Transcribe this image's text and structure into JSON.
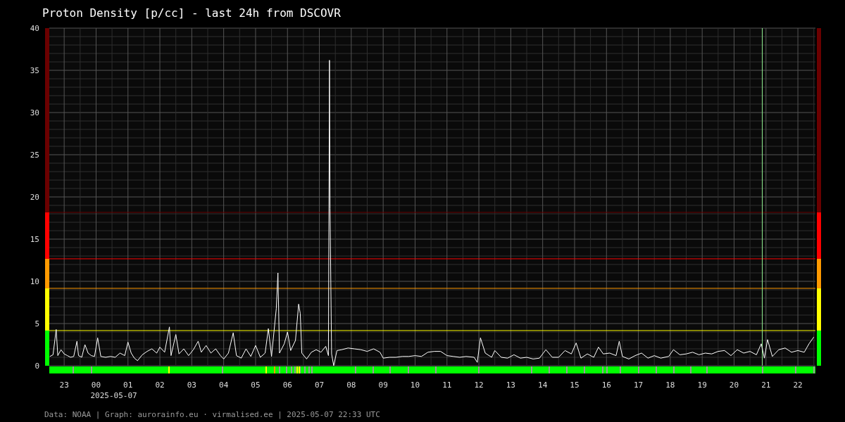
{
  "title": "Proton Density [p/cc] - last 24h from DSCOVR",
  "chart_data": {
    "type": "line",
    "grid": true,
    "xlim": [
      "2025-05-06 22:32",
      "2025-05-07 22:33"
    ],
    "ylim": [
      0,
      40
    ],
    "yticks": [
      0,
      5,
      10,
      15,
      20,
      25,
      30,
      35,
      40
    ],
    "ref_lines": [
      {
        "axis": "y",
        "value": 4.17,
        "color": "#ffff00"
      },
      {
        "axis": "y",
        "value": 9.17,
        "color": "#ff9900"
      },
      {
        "axis": "y",
        "value": 12.67,
        "color": "#ff0000"
      },
      {
        "axis": "y",
        "value": 18.17,
        "color": "#6b0000"
      },
      {
        "axis": "x",
        "value": "2025-05-07 20:53",
        "color": "#90ee90"
      }
    ],
    "xticks": [
      {
        "value": "2025-05-06 23:00",
        "label": "23"
      },
      {
        "value": "2025-05-07 00:00",
        "label": "00"
      },
      {
        "value": "2025-05-07 01:00",
        "label": "01"
      },
      {
        "value": "2025-05-07 02:00",
        "label": "02"
      },
      {
        "value": "2025-05-07 03:00",
        "label": "03"
      },
      {
        "value": "2025-05-07 04:00",
        "label": "04"
      },
      {
        "value": "2025-05-07 05:00",
        "label": "05"
      },
      {
        "value": "2025-05-07 06:00",
        "label": "06"
      },
      {
        "value": "2025-05-07 07:00",
        "label": "07"
      },
      {
        "value": "2025-05-07 08:00",
        "label": "08"
      },
      {
        "value": "2025-05-07 09:00",
        "label": "09"
      },
      {
        "value": "2025-05-07 10:00",
        "label": "10"
      },
      {
        "value": "2025-05-07 11:00",
        "label": "11"
      },
      {
        "value": "2025-05-07 12:00",
        "label": "12"
      },
      {
        "value": "2025-05-07 13:00",
        "label": "13"
      },
      {
        "value": "2025-05-07 14:00",
        "label": "14"
      },
      {
        "value": "2025-05-07 15:00",
        "label": "15"
      },
      {
        "value": "2025-05-07 16:00",
        "label": "16"
      },
      {
        "value": "2025-05-07 17:00",
        "label": "17"
      },
      {
        "value": "2025-05-07 18:00",
        "label": "18"
      },
      {
        "value": "2025-05-07 19:00",
        "label": "19"
      },
      {
        "value": "2025-05-07 20:00",
        "label": "20"
      },
      {
        "value": "2025-05-07 21:00",
        "label": "21"
      },
      {
        "value": "2025-05-07 22:00",
        "label": "22"
      }
    ],
    "x": [
      "2025-05-06 22:33",
      "2025-05-06 22:39",
      "2025-05-06 22:45",
      "2025-05-06 22:48",
      "2025-05-06 22:54",
      "2025-05-06 23:00",
      "2025-05-06 23:06",
      "2025-05-06 23:12",
      "2025-05-06 23:18",
      "2025-05-06 23:24",
      "2025-05-06 23:27",
      "2025-05-06 23:33",
      "2025-05-06 23:39",
      "2025-05-06 23:45",
      "2025-05-06 23:51",
      "2025-05-06 23:57",
      "2025-05-07 00:03",
      "2025-05-07 00:09",
      "2025-05-07 00:18",
      "2025-05-07 00:27",
      "2025-05-07 00:36",
      "2025-05-07 00:45",
      "2025-05-07 00:54",
      "2025-05-07 01:00",
      "2025-05-07 01:06",
      "2025-05-07 01:12",
      "2025-05-07 01:18",
      "2025-05-07 01:27",
      "2025-05-07 01:36",
      "2025-05-07 01:45",
      "2025-05-07 01:54",
      "2025-05-07 02:00",
      "2025-05-07 02:09",
      "2025-05-07 02:18",
      "2025-05-07 02:21",
      "2025-05-07 02:30",
      "2025-05-07 02:36",
      "2025-05-07 02:45",
      "2025-05-07 02:54",
      "2025-05-07 03:03",
      "2025-05-07 03:12",
      "2025-05-07 03:18",
      "2025-05-07 03:27",
      "2025-05-07 03:36",
      "2025-05-07 03:45",
      "2025-05-07 03:54",
      "2025-05-07 04:00",
      "2025-05-07 04:09",
      "2025-05-07 04:18",
      "2025-05-07 04:24",
      "2025-05-07 04:33",
      "2025-05-07 04:42",
      "2025-05-07 04:51",
      "2025-05-07 05:00",
      "2025-05-07 05:09",
      "2025-05-07 05:18",
      "2025-05-07 05:24",
      "2025-05-07 05:30",
      "2025-05-07 05:39",
      "2025-05-07 05:42",
      "2025-05-07 05:45",
      "2025-05-07 05:54",
      "2025-05-07 06:00",
      "2025-05-07 06:06",
      "2025-05-07 06:15",
      "2025-05-07 06:21",
      "2025-05-07 06:24",
      "2025-05-07 06:27",
      "2025-05-07 06:36",
      "2025-05-07 06:45",
      "2025-05-07 06:54",
      "2025-05-07 07:03",
      "2025-05-07 07:12",
      "2025-05-07 07:17",
      "2025-05-07 07:19",
      "2025-05-07 07:20",
      "2025-05-07 07:23",
      "2025-05-07 07:27",
      "2025-05-07 07:33",
      "2025-05-07 07:42",
      "2025-05-07 07:54",
      "2025-05-07 08:06",
      "2025-05-07 08:18",
      "2025-05-07 08:30",
      "2025-05-07 08:42",
      "2025-05-07 08:54",
      "2025-05-07 09:00",
      "2025-05-07 09:12",
      "2025-05-07 09:24",
      "2025-05-07 09:36",
      "2025-05-07 09:48",
      "2025-05-07 10:00",
      "2025-05-07 10:12",
      "2025-05-07 10:24",
      "2025-05-07 10:36",
      "2025-05-07 10:48",
      "2025-05-07 11:00",
      "2025-05-07 11:12",
      "2025-05-07 11:24",
      "2025-05-07 11:36",
      "2025-05-07 11:51",
      "2025-05-07 11:57",
      "2025-05-07 12:03",
      "2025-05-07 12:12",
      "2025-05-07 12:24",
      "2025-05-07 12:30",
      "2025-05-07 12:42",
      "2025-05-07 12:54",
      "2025-05-07 13:06",
      "2025-05-07 13:18",
      "2025-05-07 13:30",
      "2025-05-07 13:42",
      "2025-05-07 13:54",
      "2025-05-07 14:06",
      "2025-05-07 14:18",
      "2025-05-07 14:30",
      "2025-05-07 14:42",
      "2025-05-07 14:54",
      "2025-05-07 15:03",
      "2025-05-07 15:12",
      "2025-05-07 15:24",
      "2025-05-07 15:36",
      "2025-05-07 15:45",
      "2025-05-07 15:54",
      "2025-05-07 16:06",
      "2025-05-07 16:18",
      "2025-05-07 16:24",
      "2025-05-07 16:30",
      "2025-05-07 16:42",
      "2025-05-07 16:54",
      "2025-05-07 17:06",
      "2025-05-07 17:18",
      "2025-05-07 17:30",
      "2025-05-07 17:42",
      "2025-05-07 17:57",
      "2025-05-07 18:06",
      "2025-05-07 18:18",
      "2025-05-07 18:30",
      "2025-05-07 18:42",
      "2025-05-07 18:54",
      "2025-05-07 19:06",
      "2025-05-07 19:18",
      "2025-05-07 19:30",
      "2025-05-07 19:42",
      "2025-05-07 19:54",
      "2025-05-07 20:06",
      "2025-05-07 20:18",
      "2025-05-07 20:30",
      "2025-05-07 20:42",
      "2025-05-07 20:51",
      "2025-05-07 20:57",
      "2025-05-07 21:03",
      "2025-05-07 21:12",
      "2025-05-07 21:24",
      "2025-05-07 21:36",
      "2025-05-07 21:48",
      "2025-05-07 22:00",
      "2025-05-07 22:12",
      "2025-05-07 22:21",
      "2025-05-07 22:30"
    ],
    "series": [
      {
        "color": "#ffffff",
        "values": [
          1.1,
          1.3,
          4.3,
          1.2,
          1.9,
          1.4,
          1.2,
          1.0,
          1.1,
          2.9,
          1.2,
          1.0,
          2.5,
          1.5,
          1.2,
          1.1,
          3.3,
          1.1,
          1.0,
          1.1,
          1.0,
          1.5,
          1.2,
          2.8,
          1.5,
          0.9,
          0.6,
          1.3,
          1.7,
          2.0,
          1.5,
          2.2,
          1.6,
          4.6,
          1.2,
          3.7,
          1.4,
          2.0,
          1.2,
          1.9,
          2.9,
          1.6,
          2.4,
          1.5,
          2.0,
          1.2,
          0.8,
          1.5,
          3.9,
          1.2,
          0.9,
          2.0,
          1.1,
          2.4,
          1.0,
          1.5,
          4.4,
          1.1,
          6.8,
          11.0,
          1.5,
          2.6,
          4.0,
          1.8,
          3.0,
          7.3,
          6.2,
          1.5,
          0.8,
          1.6,
          1.9,
          1.6,
          2.3,
          1.2,
          36.2,
          18.6,
          1.4,
          0.0,
          1.8,
          1.9,
          2.1,
          2.0,
          1.9,
          1.7,
          2.0,
          1.6,
          0.9,
          1.0,
          1.0,
          1.1,
          1.1,
          1.2,
          1.1,
          1.6,
          1.7,
          1.7,
          1.2,
          1.1,
          1.0,
          1.1,
          1.0,
          0.4,
          3.3,
          1.5,
          1.0,
          1.8,
          1.0,
          0.9,
          1.3,
          0.9,
          1.0,
          0.8,
          0.9,
          1.9,
          1.0,
          1.0,
          1.8,
          1.4,
          2.7,
          0.9,
          1.4,
          1.0,
          2.2,
          1.4,
          1.5,
          1.2,
          2.9,
          1.1,
          0.8,
          1.2,
          1.5,
          0.9,
          1.2,
          0.9,
          1.1,
          1.9,
          1.3,
          1.4,
          1.6,
          1.3,
          1.5,
          1.4,
          1.7,
          1.8,
          1.2,
          1.9,
          1.5,
          1.7,
          1.3,
          2.6,
          0.9,
          3.1,
          1.1,
          1.9,
          2.1,
          1.6,
          1.8,
          1.6,
          2.6,
          3.4
        ]
      }
    ]
  },
  "date_label": "2025-05-07",
  "footer": "Data: NOAA | Graph: aurorainfo.eu · virmalised.ee | 2025-05-07 22:33 UTC"
}
